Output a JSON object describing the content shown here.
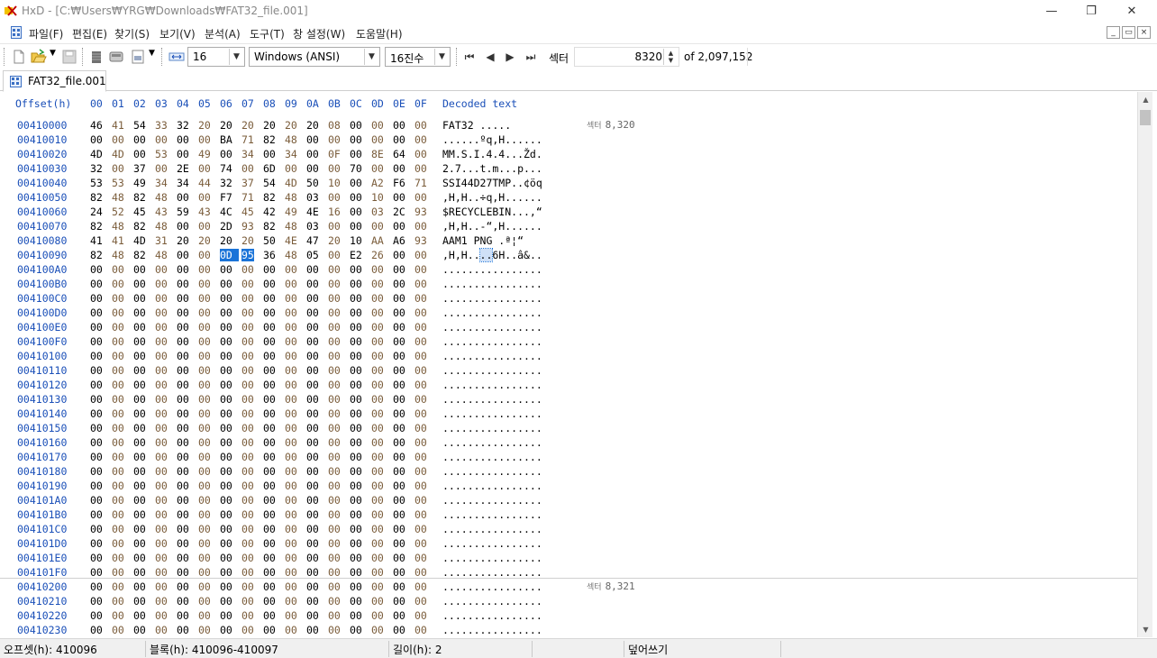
{
  "window": {
    "title": "HxD - [C:₩Users₩YRG₩Downloads₩FAT32_file.001]",
    "minimize": "—",
    "restore": "❐",
    "close": "✕"
  },
  "menu": {
    "items": [
      "파일(F)",
      "편집(E)",
      "찾기(S)",
      "보기(V)",
      "분석(A)",
      "도구(T)",
      "창 설정(W)",
      "도움말(H)"
    ],
    "mdi": [
      "_",
      "▭",
      "×"
    ]
  },
  "toolbar": {
    "bytes_per_row": "16",
    "charset": "Windows (ANSI)",
    "offset_base": "16진수",
    "sector_label": "섹터",
    "sector_value": "8320",
    "sector_of": "of 2,097,152",
    "nav": [
      "⏮",
      "◀",
      "▶",
      "⏭"
    ],
    "icons": [
      "new-file-icon",
      "open-file-icon",
      "save-icon",
      "ram-icon",
      "disk-icon",
      "image-icon"
    ]
  },
  "tab": {
    "label": "FAT32_file.001"
  },
  "hex_header": {
    "offset": "Offset(h)",
    "columns": [
      "00",
      "01",
      "02",
      "03",
      "04",
      "05",
      "06",
      "07",
      "08",
      "09",
      "0A",
      "0B",
      "0C",
      "0D",
      "0E",
      "0F"
    ],
    "decoded": "Decoded text"
  },
  "sector_label_prefix": "섹터",
  "rows": [
    {
      "off": "00410000",
      "bytes": [
        "46",
        "41",
        "54",
        "33",
        "32",
        "20",
        "20",
        "20",
        "20",
        "20",
        "20",
        "08",
        "00",
        "00",
        "00",
        "00"
      ],
      "text": "FAT32      .....",
      "sector": "8,320"
    },
    {
      "off": "00410010",
      "bytes": [
        "00",
        "00",
        "00",
        "00",
        "00",
        "00",
        "BA",
        "71",
        "82",
        "48",
        "00",
        "00",
        "00",
        "00",
        "00",
        "00"
      ],
      "text": "......ºq‚H......"
    },
    {
      "off": "00410020",
      "bytes": [
        "4D",
        "4D",
        "00",
        "53",
        "00",
        "49",
        "00",
        "34",
        "00",
        "34",
        "00",
        "0F",
        "00",
        "8E",
        "64",
        "00"
      ],
      "text": "MM.S.I.4.4...Žd."
    },
    {
      "off": "00410030",
      "bytes": [
        "32",
        "00",
        "37",
        "00",
        "2E",
        "00",
        "74",
        "00",
        "6D",
        "00",
        "00",
        "00",
        "70",
        "00",
        "00",
        "00"
      ],
      "text": "2.7...t.m...p..."
    },
    {
      "off": "00410040",
      "bytes": [
        "53",
        "53",
        "49",
        "34",
        "34",
        "44",
        "32",
        "37",
        "54",
        "4D",
        "50",
        "10",
        "00",
        "A2",
        "F6",
        "71"
      ],
      "text": "SSI44D27TMP..¢öq"
    },
    {
      "off": "00410050",
      "bytes": [
        "82",
        "48",
        "82",
        "48",
        "00",
        "00",
        "F7",
        "71",
        "82",
        "48",
        "03",
        "00",
        "00",
        "10",
        "00",
        "00"
      ],
      "text": "‚H‚H..÷q‚H......"
    },
    {
      "off": "00410060",
      "bytes": [
        "24",
        "52",
        "45",
        "43",
        "59",
        "43",
        "4C",
        "45",
        "42",
        "49",
        "4E",
        "16",
        "00",
        "03",
        "2C",
        "93"
      ],
      "text": "$RECYCLEBIN...,“"
    },
    {
      "off": "00410070",
      "bytes": [
        "82",
        "48",
        "82",
        "48",
        "00",
        "00",
        "2D",
        "93",
        "82",
        "48",
        "03",
        "00",
        "00",
        "00",
        "00",
        "00"
      ],
      "text": "‚H‚H..-“‚H......"
    },
    {
      "off": "00410080",
      "bytes": [
        "41",
        "41",
        "4D",
        "31",
        "20",
        "20",
        "20",
        "20",
        "50",
        "4E",
        "47",
        "20",
        "10",
        "AA",
        "A6",
        "93"
      ],
      "text": "AAM1    PNG .ª¦“"
    },
    {
      "off": "00410090",
      "bytes": [
        "82",
        "48",
        "82",
        "48",
        "00",
        "00",
        "0D",
        "95",
        "36",
        "48",
        "05",
        "00",
        "E2",
        "26",
        "00",
        "00"
      ],
      "text": "‚H‚H..•6H..â&..",
      "sel": [
        6,
        7
      ]
    },
    {
      "off": "004100A0",
      "zero": true
    },
    {
      "off": "004100B0",
      "zero": true
    },
    {
      "off": "004100C0",
      "zero": true
    },
    {
      "off": "004100D0",
      "zero": true
    },
    {
      "off": "004100E0",
      "zero": true
    },
    {
      "off": "004100F0",
      "zero": true
    },
    {
      "off": "00410100",
      "zero": true
    },
    {
      "off": "00410110",
      "zero": true
    },
    {
      "off": "00410120",
      "zero": true
    },
    {
      "off": "00410130",
      "zero": true
    },
    {
      "off": "00410140",
      "zero": true
    },
    {
      "off": "00410150",
      "zero": true
    },
    {
      "off": "00410160",
      "zero": true
    },
    {
      "off": "00410170",
      "zero": true
    },
    {
      "off": "00410180",
      "zero": true
    },
    {
      "off": "00410190",
      "zero": true
    },
    {
      "off": "004101A0",
      "zero": true
    },
    {
      "off": "004101B0",
      "zero": true
    },
    {
      "off": "004101C0",
      "zero": true
    },
    {
      "off": "004101D0",
      "zero": true
    },
    {
      "off": "004101E0",
      "zero": true
    },
    {
      "off": "004101F0",
      "zero": true
    },
    {
      "off": "00410200",
      "zero": true,
      "sector": "8,321",
      "divider": true
    },
    {
      "off": "00410210",
      "zero": true
    },
    {
      "off": "00410220",
      "zero": true
    },
    {
      "off": "00410230",
      "zero": true
    }
  ],
  "zero_text": "................",
  "status": {
    "offset": "오프셋(h): 410096",
    "block": "블록(h): 410096-410097",
    "length": "길이(h): 2",
    "mode": "덮어쓰기"
  }
}
